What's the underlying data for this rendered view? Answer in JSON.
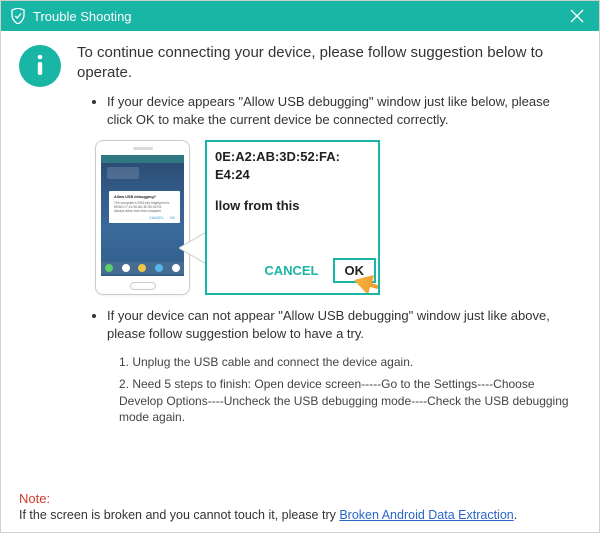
{
  "titlebar": {
    "title": "Trouble Shooting"
  },
  "heading": "To continue connecting your device, please follow suggestion below to operate.",
  "bullet1": "If your device appears \"Allow USB debugging\" window just like below, please click OK to make the current device  be connected correctly.",
  "phone_popup": {
    "title": "Allow USB debugging?",
    "line1": "The computer's RSA key fingerprint is:",
    "line2": "85:B4:C7:31:36:AD:3E:50:52:FA",
    "check": "Always allow from this computer",
    "cancel": "CANCEL",
    "ok": "OK"
  },
  "detail": {
    "mac1": "0E:A2:AB:3D:52:FA:",
    "mac2": "E4:24",
    "partial": "llow from this",
    "cancel": "CANCEL",
    "ok": "OK"
  },
  "bullet2": "If your device can not appear \"Allow USB debugging\" window just like above, please follow suggestion below to have a try.",
  "steps": {
    "s1": "1. Unplug the USB cable and connect the device again.",
    "s2": "2. Need 5 steps to finish: Open device screen-----Go to the Settings----Choose Develop Options----Uncheck the USB debugging mode----Check the USB debugging mode again."
  },
  "note": {
    "label": "Note:",
    "text_before": "If the screen is broken and you cannot touch it, please try ",
    "link": "Broken Android Data Extraction",
    "text_after": "."
  }
}
